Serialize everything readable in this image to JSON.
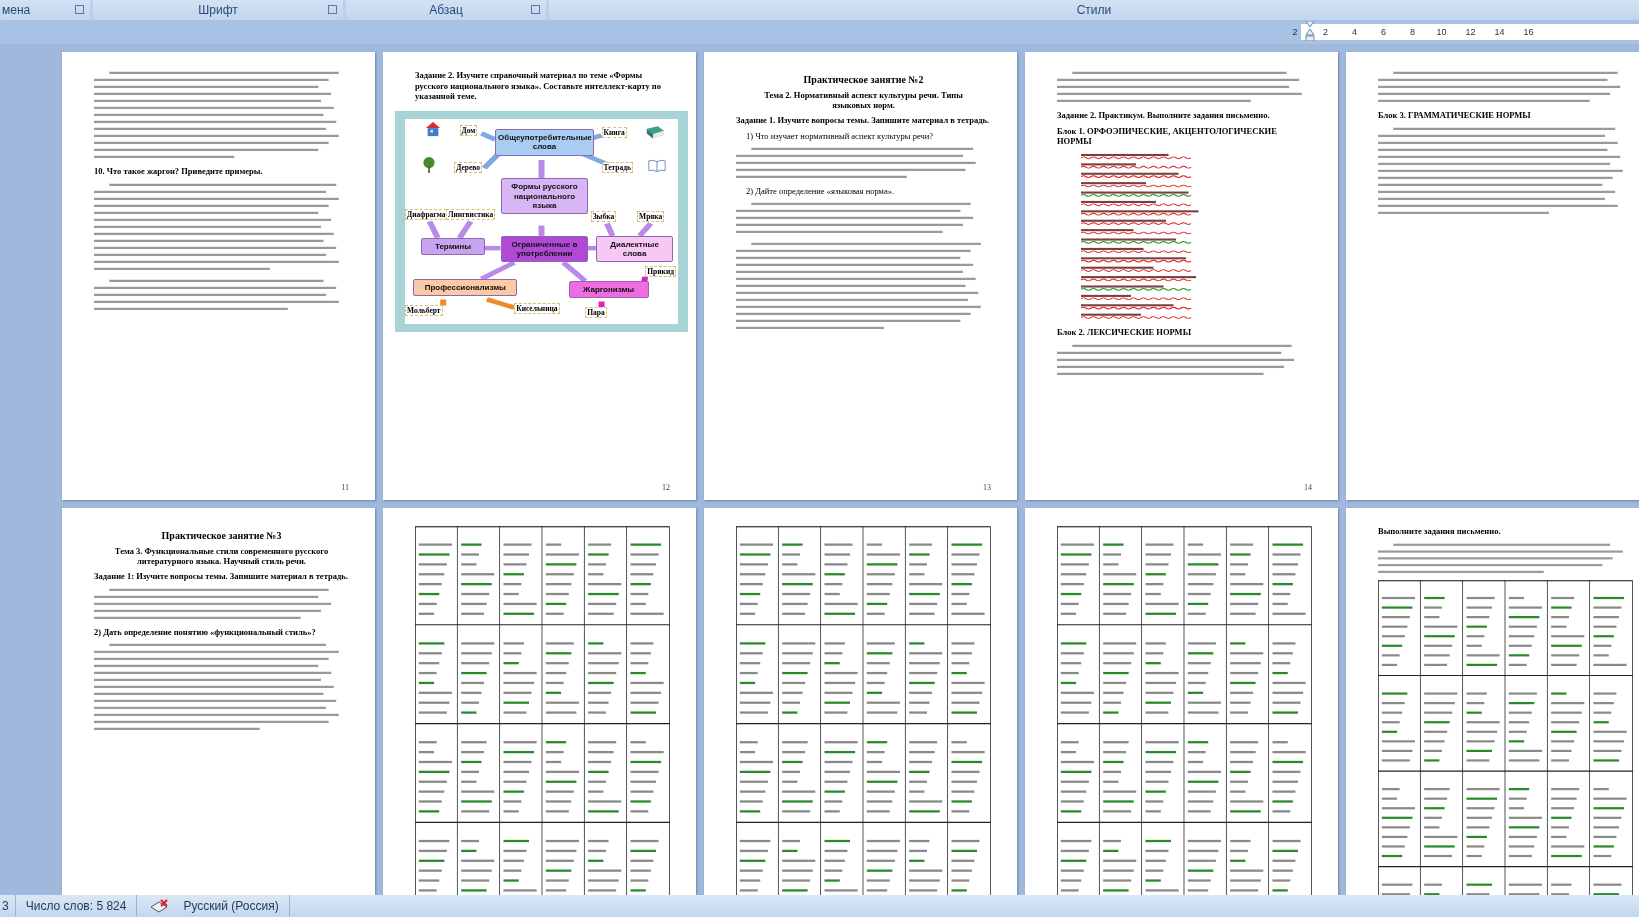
{
  "ribbon_groups": [
    {
      "label": "мена",
      "launcher": true
    },
    {
      "label": "Шрифт",
      "launcher": true
    },
    {
      "label": "Абзац",
      "launcher": true
    },
    {
      "label": "Стили",
      "launcher": false
    }
  ],
  "ruler": {
    "ticks": [
      "2",
      "2",
      "4",
      "6",
      "8",
      "10",
      "12",
      "14",
      "16"
    ]
  },
  "pages": [
    {
      "kind": "text",
      "page_number": "11",
      "blocks": [
        {
          "kind": "lines-long"
        },
        {
          "kind": "bold",
          "text": "10. Что такое жаргон? Приведите примеры."
        },
        {
          "kind": "lines-long"
        },
        {
          "kind": "lines"
        }
      ]
    },
    {
      "kind": "mindmap",
      "page_number": "12",
      "blocks": [
        {
          "kind": "bold",
          "text": "Задание 2. Изучите справочный материал по теме «Формы русского национального языка». Составьте интеллект-карту по указанной теме."
        }
      ],
      "mindmap": {
        "nodes": [
          {
            "text": "Общеупотребительные слова",
            "color": "#a9cdf2"
          },
          {
            "text": "Формы русского национального языка",
            "color": "#d7b4f3"
          },
          {
            "text": "Термины",
            "color": "#c7a3f0"
          },
          {
            "text": "Ограниченные в употреблении",
            "color": "#b04ad6"
          },
          {
            "text": "Диалектные слова",
            "color": "#f6c8f3"
          },
          {
            "text": "Профессионализмы",
            "color": "#fbc9a3"
          },
          {
            "text": "Жаргонизмы",
            "color": "#ef6be0"
          }
        ],
        "leaves": [
          "Дом",
          "Книга",
          "Дерево",
          "Тетрадь",
          "Диафрагма",
          "Лингвистика",
          "Зыбка",
          "Мряка",
          "Прикид",
          "Кисельница",
          "Мольберт",
          "Пара"
        ]
      }
    },
    {
      "kind": "text",
      "page_number": "13",
      "blocks": [
        {
          "kind": "title",
          "text": "Практическое занятие №2"
        },
        {
          "kind": "subtitle",
          "text": "Тема 2. Нормативный аспект культуры речи. Типы языковых норм."
        },
        {
          "kind": "bold",
          "text": "Задание 1. Изучите вопросы темы. Запишите материал в тетрадь."
        },
        {
          "kind": "plain",
          "text": "1) Что изучает нормативный аспект культуры речи?"
        },
        {
          "kind": "lines"
        },
        {
          "kind": "plain",
          "text": "2) Дайте определение «языковая норма»."
        },
        {
          "kind": "lines"
        },
        {
          "kind": "lines-long"
        }
      ]
    },
    {
      "kind": "text",
      "page_number": "14",
      "blocks": [
        {
          "kind": "lines"
        },
        {
          "kind": "bold",
          "text": "Задание 2. Практикум. Выполните задания письменно."
        },
        {
          "kind": "bold",
          "text": "Блок 1. ОРФОЭПИЧЕСКИЕ, АКЦЕНТОЛОГИЧЕСКИЕ НОРМЫ"
        },
        {
          "kind": "squiggles"
        },
        {
          "kind": "bold",
          "text": "Блок 2. ЛЕКСИЧЕСКИЕ НОРМЫ"
        },
        {
          "kind": "lines"
        }
      ]
    },
    {
      "kind": "text",
      "blocks": [
        {
          "kind": "lines"
        },
        {
          "kind": "bold",
          "text": "Блок 3. ГРАММАТИЧЕСКИЕ НОРМЫ"
        },
        {
          "kind": "lines-long"
        }
      ]
    },
    {
      "kind": "text",
      "blocks": [
        {
          "kind": "title",
          "text": "Практическое занятие №3"
        },
        {
          "kind": "subtitle",
          "text": "Тема 3. Функциональные стили современного русского литературного языка. Научный стиль речи."
        },
        {
          "kind": "bold",
          "text": "Задание 1: Изучите вопросы темы. Запишите материал в тетрадь."
        },
        {
          "kind": "lines"
        },
        {
          "kind": "bold",
          "text": "2) Дать определение понятию «функциональный стиль»?"
        },
        {
          "kind": "lines-long"
        }
      ]
    },
    {
      "kind": "table"
    },
    {
      "kind": "table"
    },
    {
      "kind": "table"
    },
    {
      "kind": "table",
      "blocks": [
        {
          "kind": "bold",
          "text": "Выполните задания письменно."
        },
        {
          "kind": "lines"
        }
      ]
    }
  ],
  "status_bar": {
    "page": "3",
    "word_count": "Число слов: 5 824",
    "language": "Русский (Россия)"
  }
}
